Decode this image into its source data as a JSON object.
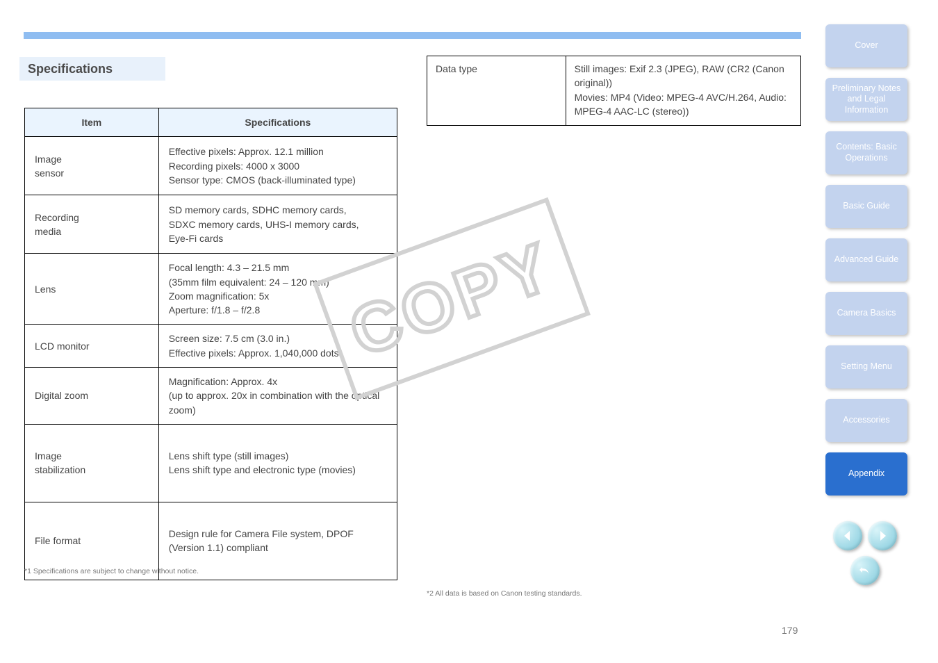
{
  "page_number": "179",
  "section_title": "Specifications",
  "spec_headers": {
    "item": "Item",
    "spec": "Specifications"
  },
  "copy_watermark": "COPY",
  "spec_table": [
    {
      "item": "Image\nsensor",
      "spec": "Effective pixels: Approx. 12.1 million\nRecording pixels: 4000 x 3000\nSensor type: CMOS (back-illuminated type)"
    },
    {
      "item": "Recording\nmedia",
      "spec": "SD memory cards, SDHC memory cards,\nSDXC memory cards, UHS-I memory cards,\nEye-Fi cards"
    },
    {
      "item": "Lens",
      "spec": "Focal length: 4.3 – 21.5 mm\n(35mm film equivalent: 24 – 120 mm)\nZoom magnification: 5x\nAperture: f/1.8 – f/2.8"
    },
    {
      "item": "LCD monitor",
      "spec": "Screen size: 7.5 cm (3.0 in.)\nEffective pixels: Approx. 1,040,000 dots"
    },
    {
      "item": "Digital zoom",
      "spec": "Magnification: Approx. 4x\n(up to approx. 20x in combination with the optical zoom)"
    },
    {
      "item": "Image\nstabilization",
      "spec": "Lens shift type (still images)\nLens shift type and electronic type (movies)"
    },
    {
      "item": "File format",
      "spec": "Design rule for Camera File system, DPOF\n(Version 1.1) compliant"
    }
  ],
  "right_table": [
    {
      "item": "Data type",
      "spec": "Still images: Exif 2.3 (JPEG), RAW (CR2 (Canon original))\nMovies: MP4 (Video: MPEG-4 AVC/H.264, Audio: MPEG-4 AAC-LC (stereo))"
    }
  ],
  "footnote1": "*1 Specifications are subject to change without notice.",
  "footnote2": "*2 All data is based on Canon testing standards.",
  "sidebar": [
    {
      "label": "Cover",
      "active": false
    },
    {
      "label": "Preliminary Notes and Legal Information",
      "active": false
    },
    {
      "label": "Contents: Basic Operations",
      "active": false
    },
    {
      "label": "Basic Guide",
      "active": false
    },
    {
      "label": "Advanced Guide",
      "active": false
    },
    {
      "label": "Camera Basics",
      "active": false
    },
    {
      "label": "Setting Menu",
      "active": false
    },
    {
      "label": "Accessories",
      "active": false
    },
    {
      "label": "Appendix",
      "active": true
    }
  ],
  "nav_buttons": {
    "prev": "Previous page",
    "next": "Next page",
    "back": "Return"
  }
}
